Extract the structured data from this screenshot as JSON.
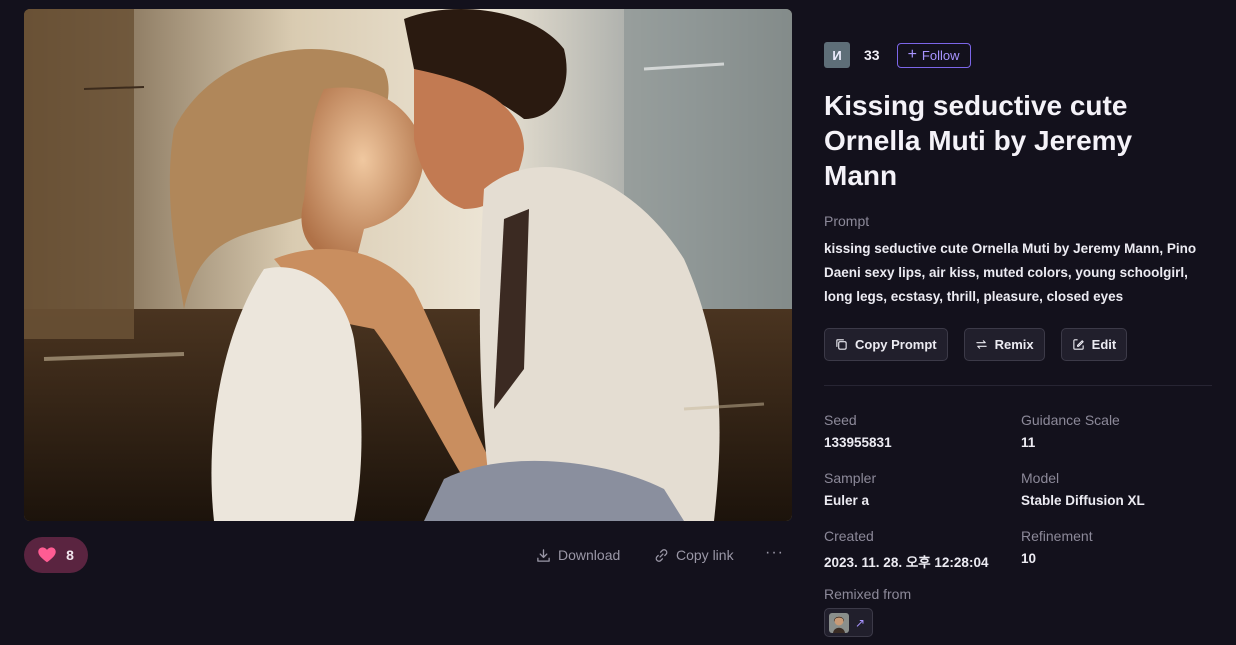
{
  "image": {
    "alt": "Kissing seductive cute Ornella Muti by Jeremy Mann"
  },
  "actions": {
    "like_count": "8",
    "download_label": "Download",
    "copy_link_label": "Copy link",
    "more_label": "···"
  },
  "author": {
    "avatar_letter": "И",
    "count": "33",
    "follow_label": "Follow"
  },
  "title": "Kissing seductive cute Ornella Muti by Jeremy Mann",
  "prompt": {
    "label": "Prompt",
    "text": "kissing seductive cute Ornella Muti by Jeremy Mann, Pino Daeni sexy lips, air kiss, muted colors, young schoolgirl, long legs, ecstasy, thrill, pleasure, closed eyes"
  },
  "buttons": {
    "copy_prompt": "Copy Prompt",
    "remix": "Remix",
    "edit": "Edit"
  },
  "meta": {
    "seed_label": "Seed",
    "seed": "133955831",
    "guidance_label": "Guidance Scale",
    "guidance": "11",
    "sampler_label": "Sampler",
    "sampler": "Euler a",
    "model_label": "Model",
    "model": "Stable Diffusion XL",
    "created_label": "Created",
    "created": "2023. 11. 28. 오후 12:28:04",
    "refinement_label": "Refinement",
    "refinement": "10",
    "remixed_from_label": "Remixed from"
  },
  "colors": {
    "background": "#13111c",
    "accent": "#7c66e8",
    "like_bg": "#5a2440",
    "heart": "#ff5c93"
  }
}
